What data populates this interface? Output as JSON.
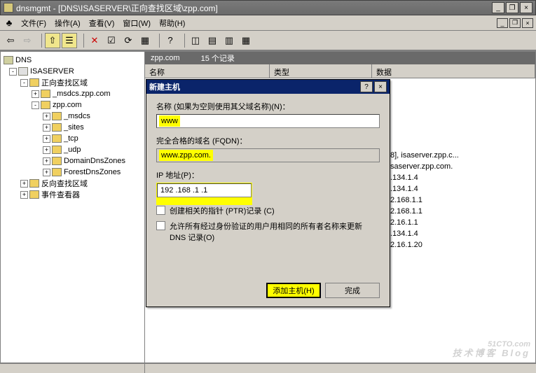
{
  "window": {
    "title": "dnsmgmt - [DNS\\ISASERVER\\正向查找区域\\zpp.com]"
  },
  "menu": {
    "icon": "dns-console-icon",
    "file": "文件(F)",
    "action": "操作(A)",
    "view": "查看(V)",
    "window": "窗口(W)",
    "help": "帮助(H)"
  },
  "tree": {
    "root": "DNS",
    "server": "ISASERVER",
    "fwdzone": "正向查找区域",
    "msdcs_zpp": "_msdcs.zpp.com",
    "zpp": "zpp.com",
    "msdcs": "_msdcs",
    "sites": "_sites",
    "tcp": "_tcp",
    "udp": "_udp",
    "ddz": "DomainDnsZones",
    "fdz": "ForestDnsZones",
    "revzone": "反向查找区域",
    "eventviewer": "事件查看器"
  },
  "right": {
    "zone": "zpp.com",
    "count": "15 个记录",
    "col_name": "名称",
    "col_type": "类型",
    "col_data": "数据",
    "peek1": "8], isaserver.zpp.c...",
    "peek2": "saserver.zpp.com.",
    "peek3": ".134.1.4",
    "peek4": ".134.1.4",
    "peek5": "2.168.1.1",
    "peek6": "2.168.1.1",
    "peek7": "2.16.1.1",
    "peek8": ".134.1.4",
    "peek9": "2.16.1.20"
  },
  "dialog": {
    "title": "新建主机",
    "name_label": "名称 (如果为空则使用其父域名称)(N)：",
    "name_value": "www",
    "fqdn_label": "完全合格的域名 (FQDN)：",
    "fqdn_value": "www.zpp.com.",
    "ip_label": "IP 地址(P)：",
    "ip_value": "192 .168 .1    .1",
    "chk_ptr": "创建相关的指针 (PTR)记录 (C)",
    "chk_auth": "允许所有经过身份验证的用户用相同的所有者名称来更新 DNS 记录(O)",
    "btn_add": "添加主机(H)",
    "btn_done": "完成"
  },
  "watermark": {
    "main": "51CTO.com",
    "sub": "技术博客  Blog"
  }
}
